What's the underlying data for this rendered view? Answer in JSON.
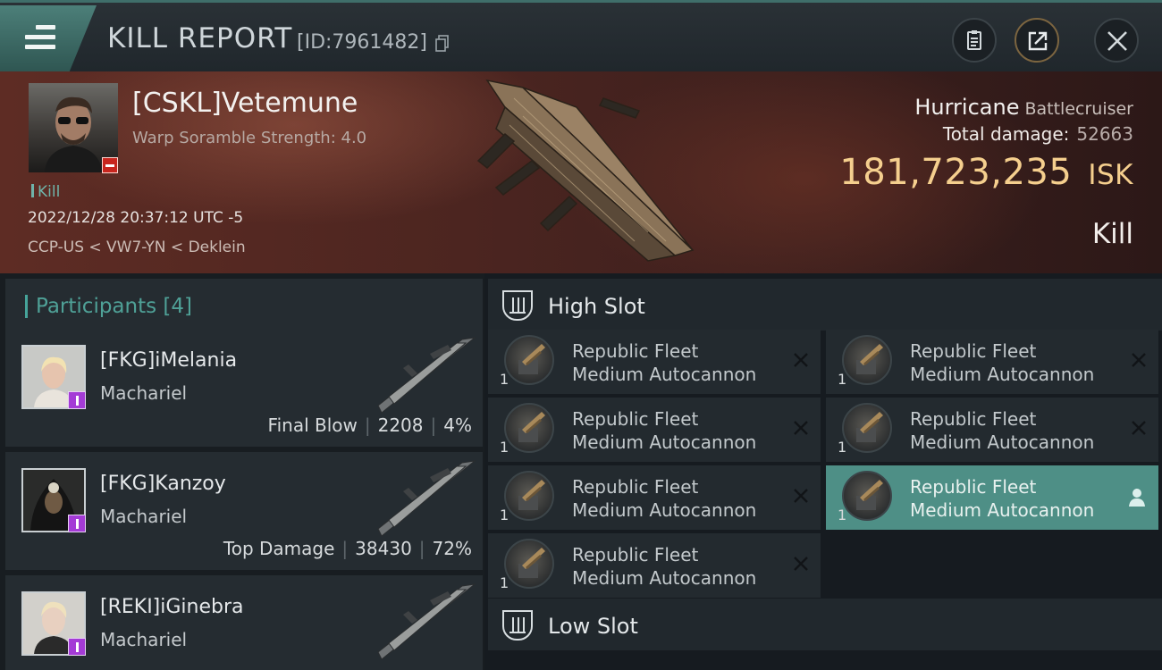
{
  "header": {
    "title": "KILL REPORT",
    "report_id": "[ID:7961482]",
    "buttons": [
      "clipboard-icon",
      "share-icon",
      "close-icon"
    ]
  },
  "victim": {
    "name": "[CSKL]Vetemune",
    "subtitle": "Warp Soramble Strength: 4.0",
    "tag": "Kill",
    "datetime": "2022/12/28 20:37:12 UTC -5",
    "location": "CCP-US < VW7-YN < Deklein",
    "ship_name": "Hurricane",
    "ship_class": "Battlecruiser",
    "damage_label": "Total damage:",
    "damage_value": "52663",
    "isk_value": "181,723,235",
    "isk_unit": "ISK",
    "result": "Kill",
    "standing_color": "#c8261e"
  },
  "participants": {
    "title": "Participants [4]",
    "rows": [
      {
        "name": "[FKG]iMelania",
        "ship": "Machariel",
        "label": "Final Blow",
        "damage": "2208",
        "percent": "4%"
      },
      {
        "name": "[FKG]Kanzoy",
        "ship": "Machariel",
        "label": "Top Damage",
        "damage": "38430",
        "percent": "72%"
      },
      {
        "name": "[REKI]iGinebra",
        "ship": "Machariel"
      }
    ]
  },
  "slots": {
    "high": {
      "title": "High Slot",
      "modules": [
        {
          "line1": "Republic Fleet",
          "line2": "Medium Autocannon",
          "qty": "1",
          "selected": false
        },
        {
          "line1": "Republic Fleet",
          "line2": "Medium Autocannon",
          "qty": "1",
          "selected": false
        },
        {
          "line1": "Republic Fleet",
          "line2": "Medium Autocannon",
          "qty": "1",
          "selected": false
        },
        {
          "line1": "Republic Fleet",
          "line2": "Medium Autocannon",
          "qty": "1",
          "selected": false
        },
        {
          "line1": "Republic Fleet",
          "line2": "Medium Autocannon",
          "qty": "1",
          "selected": false
        },
        {
          "line1": "Republic Fleet",
          "line2": "Medium Autocannon",
          "qty": "1",
          "selected": true
        },
        {
          "line1": "Republic Fleet",
          "line2": "Medium Autocannon",
          "qty": "1",
          "selected": false
        }
      ]
    },
    "low": {
      "title": "Low Slot"
    }
  },
  "colors": {
    "accent": "#4fa197",
    "isk": "#f5cf8e",
    "selected_module": "#4e8f86",
    "corp_badge": "#a43bd6"
  }
}
